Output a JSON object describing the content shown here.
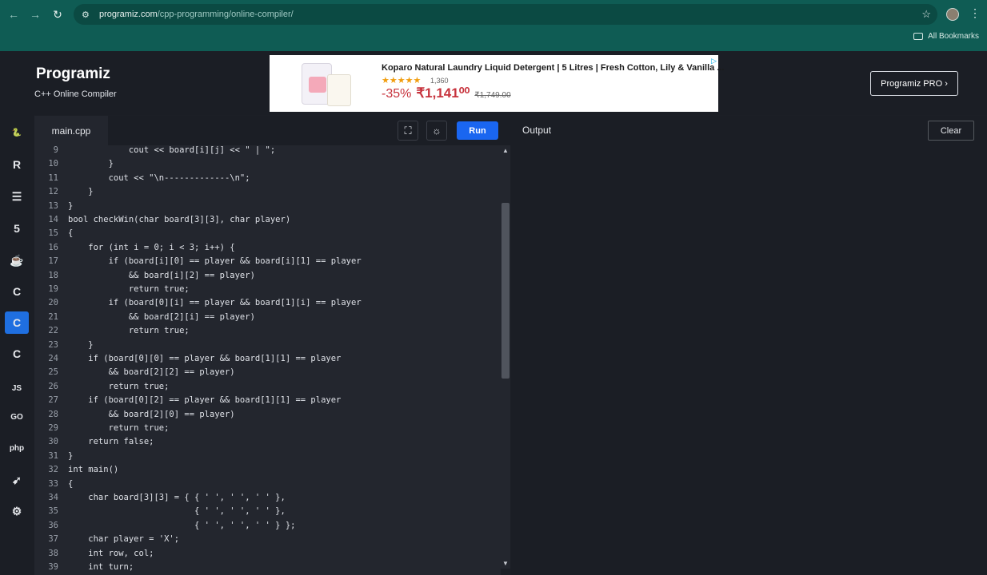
{
  "browser": {
    "url_host": "programiz.com",
    "url_path": "/cpp-programming/online-compiler/",
    "bookmarks_label": "All Bookmarks"
  },
  "header": {
    "logo": "Programiz",
    "subtitle": "C++ Online Compiler",
    "pro_button": "Programiz PRO ›"
  },
  "ad": {
    "title": "Koparo Natural Laundry Liquid Detergent | 5 Litres | Fresh Cotton, Lily & Vanilla ...",
    "stars": "★★★★★",
    "reviews": "1,360",
    "discount": "-35%",
    "price": "₹1,141⁰⁰",
    "mrp": "₹1,749.00",
    "adchoice": "▷"
  },
  "languages": [
    {
      "name": "python",
      "glyph": "🐍"
    },
    {
      "name": "r",
      "glyph": "R"
    },
    {
      "name": "sql",
      "glyph": "☰"
    },
    {
      "name": "html",
      "glyph": "5"
    },
    {
      "name": "java",
      "glyph": "☕"
    },
    {
      "name": "c",
      "glyph": "C"
    },
    {
      "name": "cpp",
      "glyph": "C"
    },
    {
      "name": "csharp",
      "glyph": "C"
    },
    {
      "name": "js",
      "glyph": "JS"
    },
    {
      "name": "go",
      "glyph": "GO"
    },
    {
      "name": "php",
      "glyph": "php"
    },
    {
      "name": "swift",
      "glyph": "➹"
    },
    {
      "name": "rust",
      "glyph": "⚙"
    }
  ],
  "editor": {
    "file_tab": "main.cpp",
    "run_label": "Run",
    "fullscreen_glyph": "⛶",
    "theme_glyph": "☼"
  },
  "code_lines": [
    {
      "n": "9",
      "t": "            cout << board[i][j] << \" | \";"
    },
    {
      "n": "10",
      "t": "        }"
    },
    {
      "n": "11",
      "t": "        cout << \"\\n-------------\\n\";"
    },
    {
      "n": "12",
      "t": "    }"
    },
    {
      "n": "13",
      "t": "}"
    },
    {
      "n": "14",
      "t": "bool checkWin(char board[3][3], char player)"
    },
    {
      "n": "15",
      "t": "{"
    },
    {
      "n": "16",
      "t": "    for (int i = 0; i < 3; i++) {"
    },
    {
      "n": "17",
      "t": "        if (board[i][0] == player && board[i][1] == player"
    },
    {
      "n": "18",
      "t": "            && board[i][2] == player)"
    },
    {
      "n": "19",
      "t": "            return true;"
    },
    {
      "n": "20",
      "t": "        if (board[0][i] == player && board[1][i] == player"
    },
    {
      "n": "21",
      "t": "            && board[2][i] == player)"
    },
    {
      "n": "22",
      "t": "            return true;"
    },
    {
      "n": "23",
      "t": "    }"
    },
    {
      "n": "24",
      "t": "    if (board[0][0] == player && board[1][1] == player"
    },
    {
      "n": "25",
      "t": "        && board[2][2] == player)"
    },
    {
      "n": "26",
      "t": "        return true;"
    },
    {
      "n": "27",
      "t": "    if (board[0][2] == player && board[1][1] == player"
    },
    {
      "n": "28",
      "t": "        && board[2][0] == player)"
    },
    {
      "n": "29",
      "t": "        return true;"
    },
    {
      "n": "30",
      "t": "    return false;"
    },
    {
      "n": "31",
      "t": "}"
    },
    {
      "n": "32",
      "t": "int main()"
    },
    {
      "n": "33",
      "t": "{"
    },
    {
      "n": "34",
      "t": "    char board[3][3] = { { ' ', ' ', ' ' },"
    },
    {
      "n": "35",
      "t": "                         { ' ', ' ', ' ' },"
    },
    {
      "n": "36",
      "t": "                         { ' ', ' ', ' ' } };"
    },
    {
      "n": "37",
      "t": "    char player = 'X';"
    },
    {
      "n": "38",
      "t": "    int row, col;"
    },
    {
      "n": "39",
      "t": "    int turn;"
    }
  ],
  "output": {
    "title": "Output",
    "clear_label": "Clear"
  }
}
